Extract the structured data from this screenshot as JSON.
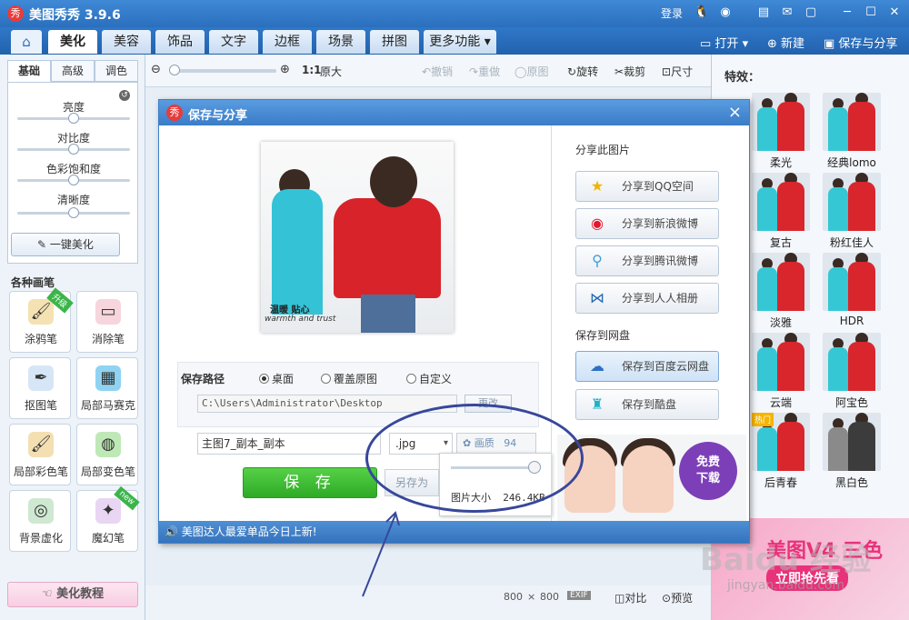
{
  "app": {
    "title": "美图秀秀 3.9.6",
    "logo_char": "秀",
    "login": "登录"
  },
  "main_tabs": [
    "美化",
    "美容",
    "饰品",
    "文字",
    "边框",
    "场景",
    "拼图",
    "更多功能"
  ],
  "top_actions": {
    "open": "打开",
    "new": "新建",
    "save_share": "保存与分享"
  },
  "left": {
    "subtabs": [
      "基础",
      "高级",
      "调色"
    ],
    "sliders": [
      "亮度",
      "对比度",
      "色彩饱和度",
      "清晰度"
    ],
    "one_key": "一键美化",
    "brush_header": "各种画笔",
    "brushes": [
      "涂鸦笔",
      "消除笔",
      "抠图笔",
      "局部马赛克",
      "局部彩色笔",
      "局部变色笔",
      "背景虚化",
      "魔幻笔"
    ],
    "badges": {
      "upgrade": "升级",
      "new": "new"
    },
    "tutorial": "美化教程"
  },
  "toolbar": {
    "ratio": "1:1",
    "original_size": "原大",
    "undo": "撤销",
    "redo": "重做",
    "original": "原图",
    "rotate": "旋转",
    "crop": "裁剪",
    "size": "尺寸"
  },
  "right": {
    "title": "特效：",
    "effects": [
      "柔光",
      "经典lomo",
      "复古",
      "粉红佳人",
      "淡雅",
      "HDR",
      "云端",
      "阿宝色",
      "后青春",
      "黑白色"
    ],
    "badge_hot": "热门",
    "banner_title": "美图V4 三色",
    "banner_btn": "立即抢先看"
  },
  "status": {
    "width": "800",
    "times": "×",
    "height": "800",
    "exif": "EXIF",
    "compare": "对比",
    "preview": "预览"
  },
  "watermark": {
    "main": "Baidu 经验",
    "url": "jingyan.baidu.com"
  },
  "dialog": {
    "title": "保存与分享",
    "close": "×",
    "preview_text1": "温暖 贴心",
    "preview_text2": "warmth and trust",
    "path_label": "保存路径",
    "radios": [
      "桌面",
      "覆盖原图",
      "自定义"
    ],
    "path_value": "C:\\Users\\Administrator\\Desktop",
    "change_button": "更改",
    "filename": "主图7_副本_副本",
    "format": ".jpg",
    "quality_label": "画质",
    "quality_value": "94",
    "quality_fraction": 0.94,
    "size_label": "图片大小",
    "size_value": "246.4KB",
    "save_button": "保 存",
    "save_as_button": "另存为",
    "share_header": "分享此图片",
    "share_buttons": [
      "分享到QQ空间",
      "分享到新浪微博",
      "分享到腾讯微博",
      "分享到人人相册"
    ],
    "cloud_header": "保存到网盘",
    "cloud_buttons": [
      "保存到百度云网盘",
      "保存到酷盘"
    ],
    "ad_free": "免费",
    "ad_download": "下载",
    "footer": "美图达人最爱单品今日上新!"
  }
}
